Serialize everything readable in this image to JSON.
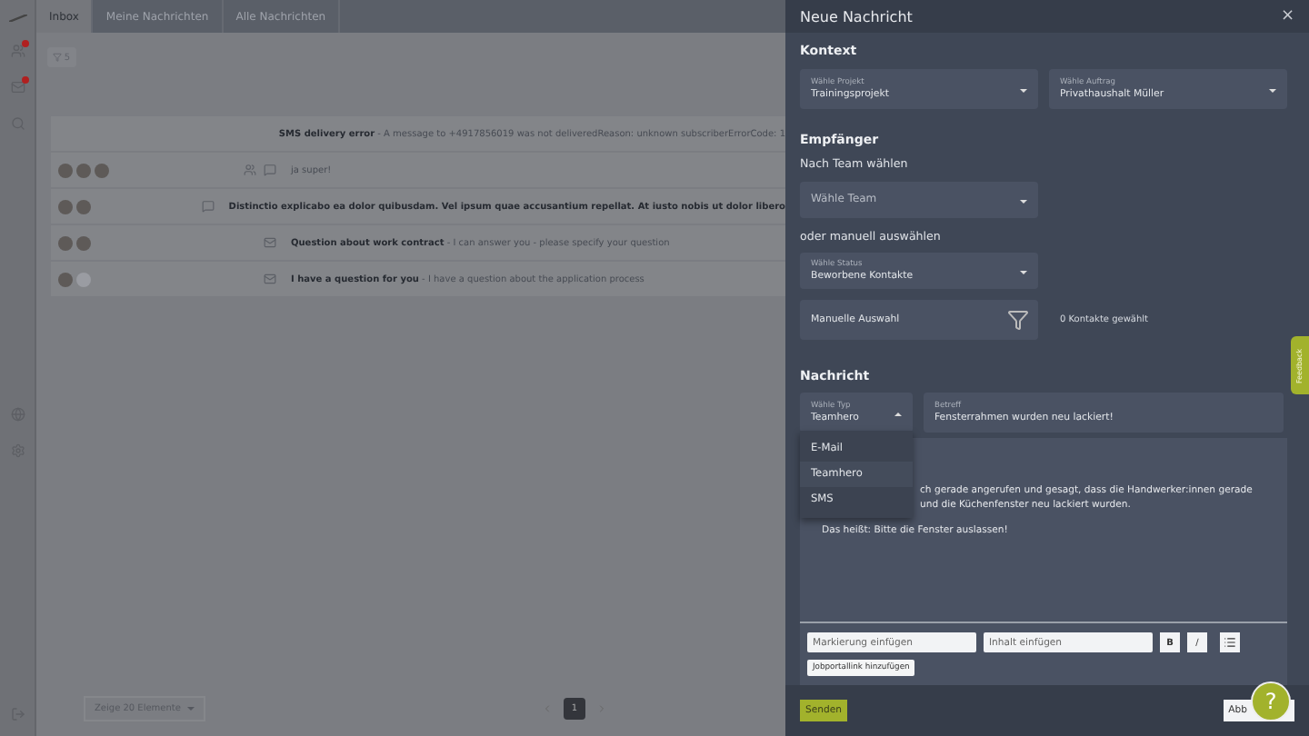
{
  "tabs": [
    {
      "label": "Inbox",
      "selected": true
    },
    {
      "label": "Meine Nachrichten",
      "selected": false
    },
    {
      "label": "Alle Nachrichten",
      "selected": false
    }
  ],
  "filter": {
    "count": "5"
  },
  "messages": [
    {
      "group": false,
      "kind": "sms",
      "subject": "SMS delivery error",
      "preview": " - A message to +4917856019 was not deliveredReason: unknown subscriberErrorCode: 1"
    },
    {
      "avatars": [
        {
          "kind": "photo"
        },
        {
          "kind": "photo"
        },
        {
          "kind": "photo"
        }
      ],
      "group": true,
      "kind": "chat",
      "preview": "ja super!"
    },
    {
      "avatars": [
        {
          "kind": "photo"
        },
        {
          "kind": "photo"
        }
      ],
      "group": false,
      "kind": "chat",
      "subject": "Distinctio explicabo ea dolor quibusdam. Vel ipsum quae accusantium repellat. At iusto nobis ut dolor libero"
    },
    {
      "avatars": [
        {
          "kind": "photo"
        },
        {
          "kind": "photo"
        }
      ],
      "group": false,
      "kind": "mail",
      "subject": "Question about work contract",
      "preview": " - I can answer you - please specify your question"
    },
    {
      "avatars": [
        {
          "kind": "photo"
        },
        {
          "kind": "blank"
        }
      ],
      "group": false,
      "kind": "mail",
      "subject": "I have a question for you",
      "preview": " - I have a question about the application process"
    }
  ],
  "page_size": "Zeige 20 Elemente",
  "pages": [
    {
      "label": "1",
      "selected": true
    }
  ],
  "drawer": {
    "title": "Neue Nachricht",
    "close": "×",
    "context": {
      "heading": "Kontext",
      "project": {
        "label": "Wähle Projekt",
        "value": "Trainingsprojekt"
      },
      "order": {
        "label": "Wähle Auftrag",
        "value": "Privathaushalt Müller"
      }
    },
    "recipients": {
      "heading": "Empfänger",
      "team_heading": "Nach Team wählen",
      "team": {
        "placeholder": "Wähle Team"
      },
      "manual_heading": "oder manuell auswählen",
      "status": {
        "label": "Wähle Status",
        "value": "Beworbene Kontakte"
      },
      "manual": "Manuelle Auswahl",
      "count": "0 Kontakte gewählt"
    },
    "message": {
      "heading": "Nachricht",
      "type": {
        "label": "Wähle Typ",
        "value": "Teamhero",
        "expanded": true,
        "options": [
          {
            "label": "E-Mail",
            "selected": false
          },
          {
            "label": "Teamhero",
            "selected": true
          },
          {
            "label": "SMS",
            "selected": false
          }
        ]
      },
      "subject": {
        "label": "Betreff",
        "value": "Fensterrahmen wurden neu lackiert!"
      },
      "body": [
        "ch gerade angerufen und gesagt, dass die Handwerker:innen gerade",
        "und die Küchenfenster neu lackiert wurden."
      ],
      "body_paragraph": "Das heißt: Bitte die Fenster auslassen!",
      "markup": {
        "placeholder": "Markierung einfügen"
      },
      "content": {
        "placeholder": "Inhalt einfügen"
      },
      "bold": "B",
      "italic": "/",
      "jobportal": "Jobportallink hinzufügen"
    },
    "send": "Senden",
    "cancel": "Abb"
  },
  "feedback": "Feedback",
  "help": "?"
}
